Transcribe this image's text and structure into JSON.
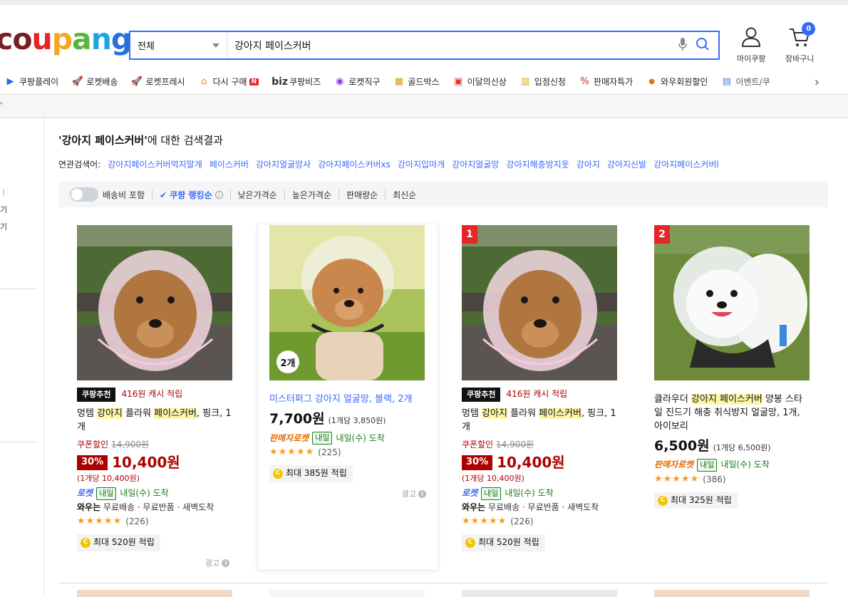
{
  "header": {
    "search_category": "전체",
    "search_query": "강아지 페이스커버",
    "mycoupang_label": "마이쿠팡",
    "cart_label": "장바구니",
    "cart_count": "0"
  },
  "logo": {
    "text": "coupang",
    "colors": [
      "#7a1f1f",
      "#e52528",
      "#f5a623",
      "#f5c400",
      "#5bb342",
      "#1ea5e0",
      "#2a6ee0"
    ]
  },
  "nav": {
    "items": [
      {
        "label": "쿠팡플레이",
        "icon": "play-icon"
      },
      {
        "label": "로켓배송",
        "icon": "rocket-icon"
      },
      {
        "label": "로켓프레시",
        "icon": "rocket-fresh-icon"
      },
      {
        "label": "다시 구매",
        "icon": "home-icon",
        "badge": "N"
      },
      {
        "label": "쿠팡비즈",
        "icon": "biz-icon",
        "prefix": "biz"
      },
      {
        "label": "로켓직구",
        "icon": "rocket-global-icon"
      },
      {
        "label": "골드박스",
        "icon": "gold-box-icon"
      },
      {
        "label": "이달의신상",
        "icon": "new-bag-icon"
      },
      {
        "label": "입점신청",
        "icon": "store-icon"
      },
      {
        "label": "판매자특가",
        "icon": "percent-icon"
      },
      {
        "label": "와우회원할인",
        "icon": "wow-icon"
      },
      {
        "label": "이벤트/쿠",
        "icon": "event-icon"
      }
    ]
  },
  "breadcrumb": "'",
  "sidebar": {
    "items": [
      "ㅣ",
      "기",
      "기"
    ]
  },
  "results": {
    "title_query": "'강아지 페이스커버'",
    "title_suffix": "에 대한 검색결과",
    "related_label": "연관검색어:",
    "related": [
      "강아지페이스커버먹지말개",
      "페이스커버",
      "강아지얼굴망사",
      "강아지페이스커버xs",
      "강아지입마개",
      "강아지얼굴망",
      "강아지해충방지옷",
      "강아지",
      "강아지신발",
      "강아지페이스커버l"
    ]
  },
  "sort": {
    "shipping_toggle": "배송비 포함",
    "options": [
      "쿠팡 랭킹순",
      "낮은가격순",
      "높은가격순",
      "판매량순",
      "최신순"
    ]
  },
  "products": [
    {
      "rec_tag": "쿠팡추천",
      "rec_cash": "416원 캐시 적립",
      "name_pre": "멍템 ",
      "name_h1": "강아지",
      "name_mid": " 플라워 ",
      "name_h2": "페이스커버",
      "name_post": ", 핑크, 1개",
      "coupon_label": "쿠폰할인",
      "original_price": "14,900원",
      "discount": "30%",
      "price": "10,400원",
      "unit_price": "(1개당 10,400원)",
      "delivery_type": "로켓",
      "delivery_tag": "내일",
      "delivery_text": "내일(수) 도착",
      "wow_label": "와우는",
      "wow_text": "무료배송 · 무료반품 · 새벽도착",
      "rating": 4.5,
      "reviews": "(226)",
      "reward": "최대 520원 적립",
      "ad": "광고"
    },
    {
      "name_link": "미스터퍼그 강아지 얼굴망, 블랙, 2개",
      "pack_badge": "2개",
      "price": "7,700원",
      "unit_price": "(1개당 3,850원)",
      "delivery_type": "판매자로켓",
      "delivery_tag": "내일",
      "delivery_text": "내일(수) 도착",
      "rating": 4.5,
      "reviews": "(225)",
      "reward": "최대 385원 적립",
      "ad": "광고"
    },
    {
      "rank": "1",
      "rec_tag": "쿠팡추천",
      "rec_cash": "416원 캐시 적립",
      "name_pre": "멍템 ",
      "name_h1": "강아지",
      "name_mid": " 플라워 ",
      "name_h2": "페이스커버",
      "name_post": ", 핑크, 1개",
      "coupon_label": "쿠폰할인",
      "original_price": "14,900원",
      "discount": "30%",
      "price": "10,400원",
      "unit_price": "(1개당 10,400원)",
      "delivery_type": "로켓",
      "delivery_tag": "내일",
      "delivery_text": "내일(수) 도착",
      "wow_label": "와우는",
      "wow_text": "무료배송 · 무료반품 · 새벽도착",
      "rating": 4.5,
      "reviews": "(226)",
      "reward": "최대 520원 적립"
    },
    {
      "rank": "2",
      "name_pre": "클라우더 ",
      "name_h1": "강아지 페이스커버",
      "name_post": " 양봉 스타일 진드기 해충 취식방지 얼굴망, 1개, 아이보리",
      "price": "6,500원",
      "unit_price": "(1개당 6,500원)",
      "delivery_type": "판매자로켓",
      "delivery_tag": "내일",
      "delivery_text": "내일(수) 도착",
      "rating": 4.5,
      "reviews": "(386)",
      "reward": "최대 325원 적립"
    }
  ]
}
